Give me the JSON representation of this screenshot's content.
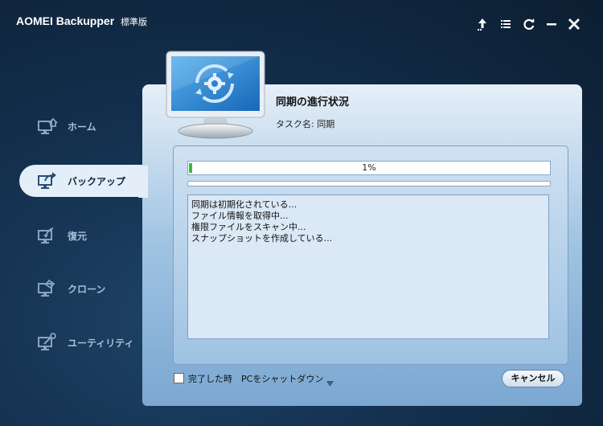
{
  "app": {
    "name": "AOMEI Backupper",
    "edition": "標準版"
  },
  "window_controls": {
    "icons": [
      "upgrade-icon",
      "menu-icon",
      "refresh-icon",
      "minimize-icon",
      "close-icon"
    ]
  },
  "sidebar": {
    "items": [
      {
        "label": "ホーム",
        "icon": "home-icon",
        "active": false
      },
      {
        "label": "バックアップ",
        "icon": "backup-icon",
        "active": true
      },
      {
        "label": "復元",
        "icon": "restore-icon",
        "active": false
      },
      {
        "label": "クローン",
        "icon": "clone-icon",
        "active": false
      },
      {
        "label": "ユーティリティ",
        "icon": "utilities-icon",
        "active": false
      }
    ]
  },
  "task": {
    "heading": "同期の進行状況",
    "name_line": "タスク名: 同期"
  },
  "progress": {
    "percent": 1,
    "text": "1%"
  },
  "log": {
    "lines": [
      "同期は初期化されている...",
      "ファイル情報を取得中...",
      "権限ファイルをスキャン中...",
      "スナップショットを作成している..."
    ]
  },
  "shutdown": {
    "checked": false,
    "label": "完了した時",
    "target": "PCをシャットダウン"
  },
  "buttons": {
    "cancel": "キャンセル"
  },
  "colors": {
    "accent": "#3cba3c",
    "background": "#143150",
    "panel": "#9fc3e2"
  }
}
